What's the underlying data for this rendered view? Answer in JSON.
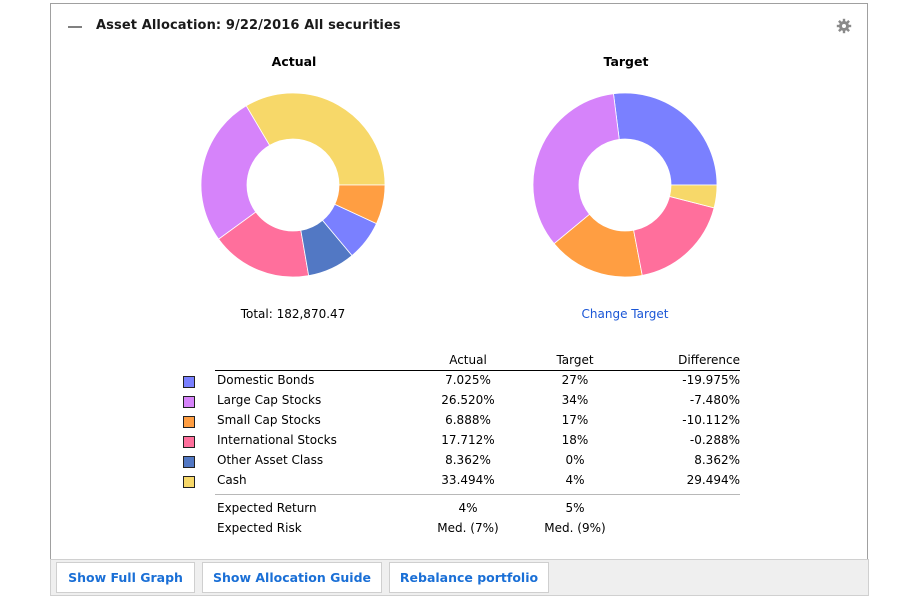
{
  "header": {
    "title": "Asset Allocation:  9/22/2016  All securities",
    "collapse_icon": "minus-icon",
    "settings_icon": "gear-icon"
  },
  "charts": {
    "actual_title": "Actual",
    "target_title": "Target",
    "total_label": "Total: 182,870.47",
    "change_target_label": "Change Target"
  },
  "colors": {
    "domestic_bonds": "#7a80ff",
    "large_cap": "#d683fa",
    "small_cap": "#ff9e42",
    "international": "#ff6f9c",
    "other": "#5278c4",
    "cash": "#f7d869"
  },
  "chart_data": [
    {
      "type": "pie",
      "title": "Actual",
      "donut": true,
      "start": "right",
      "direction": "counterclockwise",
      "slices": [
        {
          "label": "Cash",
          "value": 33.494,
          "color": "#f7d869"
        },
        {
          "label": "Large Cap Stocks",
          "value": 26.52,
          "color": "#d683fa"
        },
        {
          "label": "International Stocks",
          "value": 17.712,
          "color": "#ff6f9c"
        },
        {
          "label": "Other Asset Class",
          "value": 8.362,
          "color": "#5278c4"
        },
        {
          "label": "Domestic Bonds",
          "value": 7.025,
          "color": "#7a80ff"
        },
        {
          "label": "Small Cap Stocks",
          "value": 6.888,
          "color": "#ff9e42"
        }
      ]
    },
    {
      "type": "pie",
      "title": "Target",
      "donut": true,
      "start": "right",
      "direction": "counterclockwise",
      "slices": [
        {
          "label": "Domestic Bonds",
          "value": 27,
          "color": "#7a80ff"
        },
        {
          "label": "Large Cap Stocks",
          "value": 34,
          "color": "#d683fa"
        },
        {
          "label": "Small Cap Stocks",
          "value": 17,
          "color": "#ff9e42"
        },
        {
          "label": "International Stocks",
          "value": 18,
          "color": "#ff6f9c"
        },
        {
          "label": "Other Asset Class",
          "value": 0,
          "color": "#5278c4"
        },
        {
          "label": "Cash",
          "value": 4,
          "color": "#f7d869"
        }
      ]
    }
  ],
  "table": {
    "headers": {
      "actual": "Actual",
      "target": "Target",
      "difference": "Difference"
    },
    "rows": [
      {
        "name": "Domestic Bonds",
        "actual": "7.025%",
        "target": "27%",
        "difference": "-19.975%",
        "color": "#7a80ff"
      },
      {
        "name": "Large Cap Stocks",
        "actual": "26.520%",
        "target": "34%",
        "difference": "-7.480%",
        "color": "#d683fa"
      },
      {
        "name": "Small Cap Stocks",
        "actual": "6.888%",
        "target": "17%",
        "difference": "-10.112%",
        "color": "#ff9e42"
      },
      {
        "name": "International Stocks",
        "actual": "17.712%",
        "target": "18%",
        "difference": "-0.288%",
        "color": "#ff6f9c"
      },
      {
        "name": "Other Asset Class",
        "actual": "8.362%",
        "target": "0%",
        "difference": "8.362%",
        "color": "#5278c4"
      },
      {
        "name": "Cash",
        "actual": "33.494%",
        "target": "4%",
        "difference": "29.494%",
        "color": "#f7d869"
      }
    ],
    "summary": [
      {
        "name": "Expected Return",
        "actual": "4%",
        "target": "5%"
      },
      {
        "name": "Expected Risk",
        "actual": "Med. (7%)",
        "target": "Med. (9%)"
      }
    ]
  },
  "footer": {
    "buttons": [
      "Show Full Graph",
      "Show Allocation Guide",
      "Rebalance portfolio"
    ]
  }
}
